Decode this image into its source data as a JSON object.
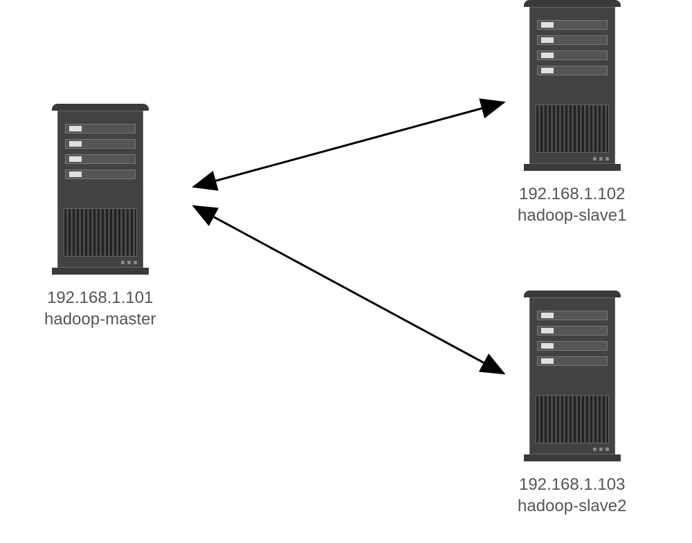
{
  "nodes": {
    "master": {
      "ip": "192.168.1.101",
      "hostname": "hadoop-master"
    },
    "slave1": {
      "ip": "192.168.1.102",
      "hostname": "hadoop-slave1"
    },
    "slave2": {
      "ip": "192.168.1.103",
      "hostname": "hadoop-slave2"
    }
  },
  "connections": [
    {
      "from": "master",
      "to": "slave1",
      "bidirectional": true
    },
    {
      "from": "master",
      "to": "slave2",
      "bidirectional": true
    }
  ],
  "colors": {
    "server_body": "#424242",
    "server_dark": "#3a3a3a",
    "arrow": "#000000",
    "text": "#555555"
  }
}
